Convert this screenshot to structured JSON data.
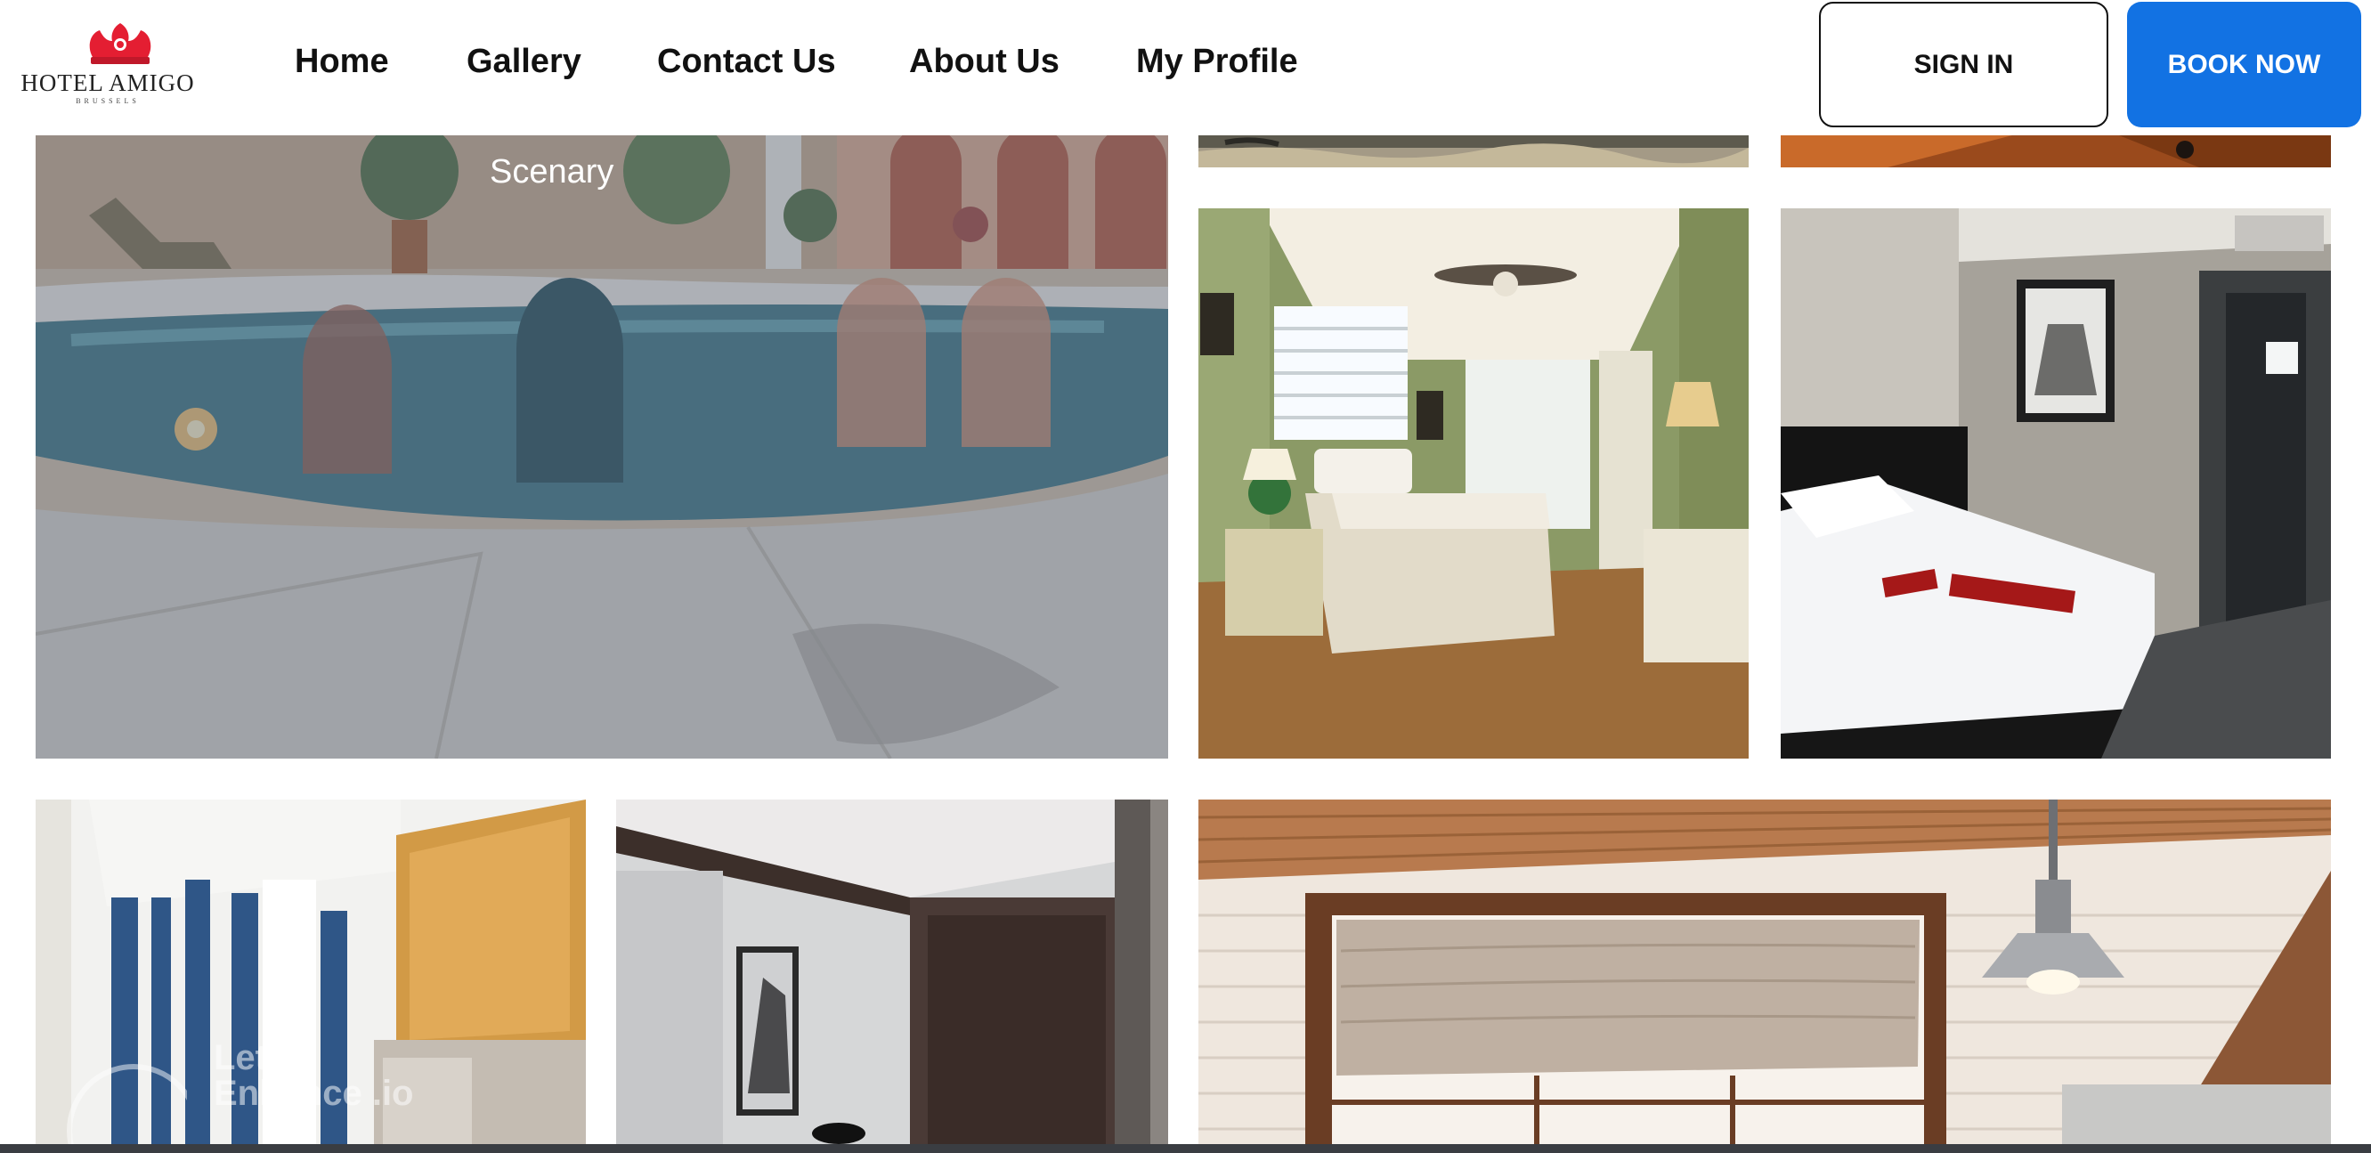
{
  "brand": {
    "name": "HOTEL AMIGO",
    "sub": "BRUSSELS",
    "accent": "#e41e32"
  },
  "nav": {
    "items": [
      {
        "label": "Home"
      },
      {
        "label": "Gallery"
      },
      {
        "label": "Contact Us"
      },
      {
        "label": "About Us"
      },
      {
        "label": "My Profile"
      }
    ]
  },
  "actions": {
    "sign_in": "SIGN IN",
    "book_now": "BOOK NOW",
    "book_color": "#1272e3"
  },
  "gallery": {
    "featured_caption": "Scenary",
    "tiles": [
      {
        "name": "pool-scenary"
      },
      {
        "name": "green-bedroom"
      },
      {
        "name": "modern-bedroom"
      },
      {
        "name": "curtain-room"
      },
      {
        "name": "dark-room"
      },
      {
        "name": "kitchen-window"
      }
    ]
  },
  "watermark": {
    "text": "Let's Enhance .io"
  }
}
